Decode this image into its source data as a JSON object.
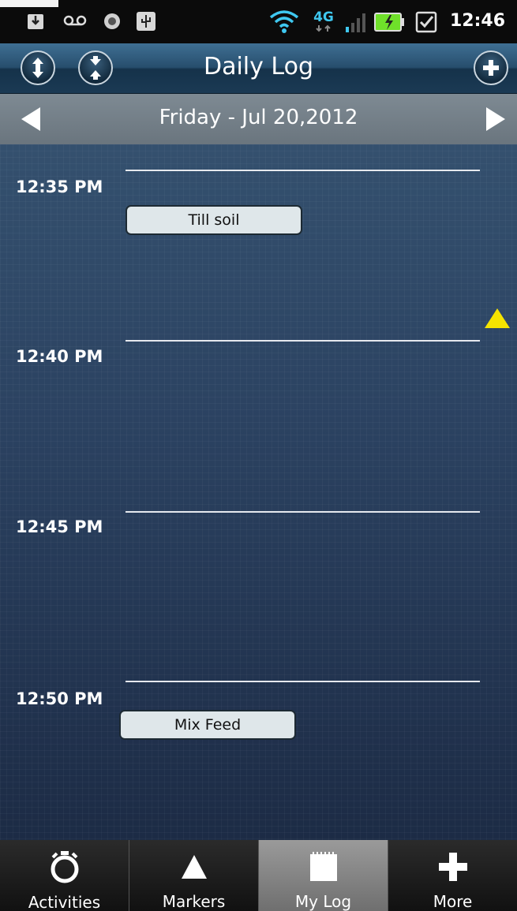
{
  "status_bar": {
    "time": "12:46",
    "network_label": "4G",
    "icons": [
      "download-icon",
      "voicemail-icon",
      "sync-icon",
      "usb-icon",
      "wifi-icon",
      "4g-icon",
      "signal-icon",
      "battery-charging-icon",
      "checkbox-icon"
    ]
  },
  "header": {
    "title": "Daily Log",
    "left_buttons": [
      "expand-icon",
      "collapse-icon"
    ],
    "right_button": "add-icon"
  },
  "date_nav": {
    "date": "Friday - Jul 20,2012",
    "prev_icon": "arrow-left-icon",
    "next_icon": "arrow-right-icon"
  },
  "log": {
    "time_slots": [
      {
        "label": "12:35 PM"
      },
      {
        "label": "12:40 PM"
      },
      {
        "label": "12:45 PM"
      },
      {
        "label": "12:50 PM"
      }
    ],
    "entries": [
      {
        "label": "Till soil"
      },
      {
        "label": "Mix Feed"
      }
    ],
    "marker_color": "#f5e400"
  },
  "tabs": [
    {
      "label": "Activities",
      "icon": "stopwatch-icon",
      "active": false
    },
    {
      "label": "Markers",
      "icon": "triangle-icon",
      "active": false
    },
    {
      "label": "My Log",
      "icon": "notepad-icon",
      "active": true
    },
    {
      "label": "More",
      "icon": "plus-icon",
      "active": false
    }
  ],
  "colors": {
    "accent_blue": "#274e6d",
    "marker": "#f5e400",
    "entry_bg": "#dfe7ea"
  }
}
